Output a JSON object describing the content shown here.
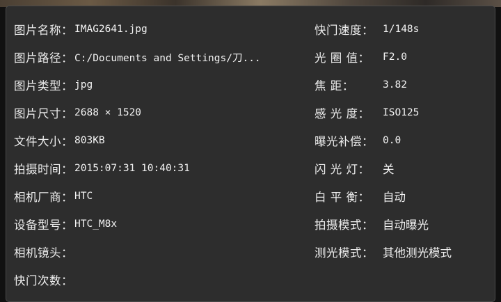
{
  "left_fields": [
    {
      "label": "图片名称：",
      "value": "IMAG2641.jpg"
    },
    {
      "label": "图片路径：",
      "value": "C:/Documents and Settings/刀..."
    },
    {
      "label": "图片类型：",
      "value": "jpg"
    },
    {
      "label": "图片尺寸：",
      "value": "2688 × 1520"
    },
    {
      "label": "文件大小：",
      "value": "803KB"
    },
    {
      "label": "拍摄时间：",
      "value": "2015:07:31 10:40:31"
    },
    {
      "label": "相机厂商：",
      "value": "HTC"
    },
    {
      "label": "设备型号：",
      "value": "HTC_M8x"
    },
    {
      "label": "相机镜头：",
      "value": ""
    },
    {
      "label": "快门次数：",
      "value": ""
    }
  ],
  "right_fields": [
    {
      "label": "快门速度：",
      "value": "1/148s"
    },
    {
      "label": "光 圈 值：",
      "value": "F2.0"
    },
    {
      "label": "焦    距：",
      "value": "3.82"
    },
    {
      "label": "感 光 度：",
      "value": "ISO125"
    },
    {
      "label": "曝光补偿：",
      "value": "0.0"
    },
    {
      "label": "闪 光 灯：",
      "value": "关"
    },
    {
      "label": "白 平 衡：",
      "value": "自动"
    },
    {
      "label": "拍摄模式：",
      "value": "自动曝光"
    },
    {
      "label": "测光模式：",
      "value": "其他测光模式"
    }
  ],
  "colors": {
    "panel_background": "#2d2d2d",
    "text": "#ededed"
  }
}
